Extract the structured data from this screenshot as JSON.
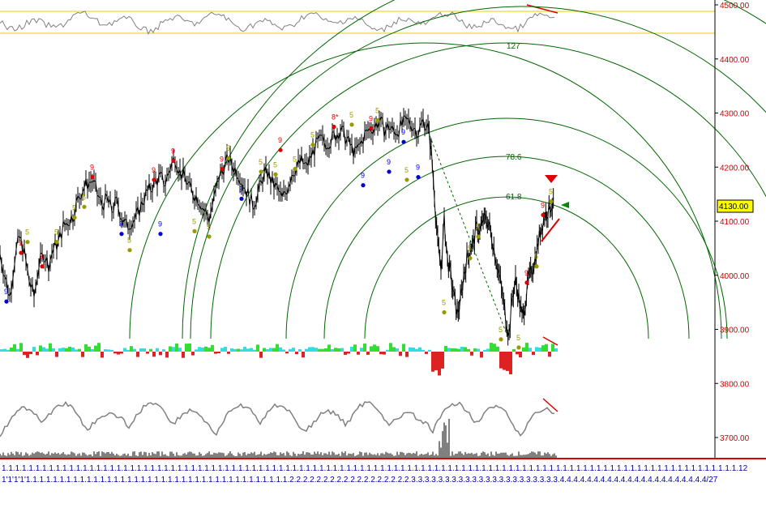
{
  "chart_data": {
    "type": "line",
    "title": "",
    "price_scale": {
      "ylim": [
        3660,
        4510
      ],
      "tick_labels": [
        "4500.00",
        "4400.00",
        "4300.00",
        "4200.00",
        "4100.00",
        "4000.00",
        "3900.00",
        "3800.00",
        "3700.00"
      ],
      "ticks": [
        4500,
        4400,
        4300,
        4200,
        4100,
        4000,
        3900,
        3800,
        3700
      ]
    },
    "current_price_label": "4130.00",
    "current_price": 4130,
    "x_axis_row1": "1.1.1.1.1.1.1.1.1.1.1.1.1.1.1.1.1.1.1.1.1.1.1.1.1.1.1.1.1.1.1.1.1.1.1.1.1.1.1.1.1.1.1.1.1.1.1.1.1.1.1.1.1.1.1.1.1.1.1.1.1.1.1.1.1.1.1.1.1.1.1.1.1.1.1.1.1.1.1.1.1.1.1.1.1.1.1.1.1.1.1.1.1.1.1.1.1.1.1.1.1.1.1.1.1.1.1.1.1.12",
    "x_axis_row2": "1'1'1'1'1.1.1.1.1.1.1.1.1.1.1.1.1.1.1.1.1.1.1.1.1.1.1.1.1.1.1.1.1.1.1.1.1.1.1.1.1.1.1.2.2.2.2.2.2.2.2.2.2.2.2.2.2.2.2.2.2.3.3.3.3.3.3.3.3.3.3.3.3.3.3.3.3.3.3.3.3.3.3.4.4.4.4.4.4.4.4.4.4.4.4.4.4.4.4.4.4.4.4.4.4/27",
    "fib_arc_labels": [
      "127",
      "78.6",
      "61.8"
    ],
    "price_series": [
      [
        0,
        4040
      ],
      [
        6,
        4000
      ],
      [
        12,
        3960
      ],
      [
        18,
        4030
      ],
      [
        24,
        4070
      ],
      [
        30,
        4040
      ],
      [
        36,
        3990
      ],
      [
        42,
        3960
      ],
      [
        48,
        4020
      ],
      [
        54,
        4040
      ],
      [
        60,
        4020
      ],
      [
        66,
        4050
      ],
      [
        72,
        4060
      ],
      [
        78,
        4090
      ],
      [
        84,
        4100
      ],
      [
        90,
        4110
      ],
      [
        96,
        4140
      ],
      [
        102,
        4160
      ],
      [
        108,
        4170
      ],
      [
        114,
        4175
      ],
      [
        120,
        4150
      ],
      [
        126,
        4130
      ],
      [
        132,
        4140
      ],
      [
        138,
        4120
      ],
      [
        144,
        4135
      ],
      [
        150,
        4110
      ],
      [
        156,
        4090
      ],
      [
        162,
        4100
      ],
      [
        168,
        4105
      ],
      [
        174,
        4130
      ],
      [
        180,
        4150
      ],
      [
        186,
        4160
      ],
      [
        192,
        4175
      ],
      [
        198,
        4180
      ],
      [
        204,
        4170
      ],
      [
        210,
        4200
      ],
      [
        216,
        4220
      ],
      [
        222,
        4190
      ],
      [
        228,
        4180
      ],
      [
        234,
        4160
      ],
      [
        240,
        4150
      ],
      [
        246,
        4140
      ],
      [
        252,
        4120
      ],
      [
        258,
        4105
      ],
      [
        264,
        4140
      ],
      [
        270,
        4180
      ],
      [
        276,
        4200
      ],
      [
        282,
        4215
      ],
      [
        288,
        4200
      ],
      [
        294,
        4190
      ],
      [
        300,
        4170
      ],
      [
        306,
        4150
      ],
      [
        312,
        4130
      ],
      [
        318,
        4150
      ],
      [
        324,
        4180
      ],
      [
        330,
        4190
      ],
      [
        336,
        4170
      ],
      [
        342,
        4160
      ],
      [
        348,
        4140
      ],
      [
        354,
        4160
      ],
      [
        360,
        4190
      ],
      [
        366,
        4200
      ],
      [
        372,
        4210
      ],
      [
        378,
        4200
      ],
      [
        384,
        4220
      ],
      [
        390,
        4240
      ],
      [
        396,
        4250
      ],
      [
        402,
        4245
      ],
      [
        408,
        4250
      ],
      [
        414,
        4260
      ],
      [
        420,
        4270
      ],
      [
        426,
        4255
      ],
      [
        432,
        4240
      ],
      [
        438,
        4225
      ],
      [
        444,
        4240
      ],
      [
        450,
        4260
      ],
      [
        456,
        4270
      ],
      [
        462,
        4275
      ],
      [
        468,
        4285
      ],
      [
        474,
        4270
      ],
      [
        480,
        4275
      ],
      [
        486,
        4265
      ],
      [
        492,
        4270
      ],
      [
        498,
        4280
      ],
      [
        504,
        4285
      ],
      [
        510,
        4275
      ],
      [
        516,
        4265
      ],
      [
        522,
        4285
      ],
      [
        528,
        4275
      ],
      [
        532,
        4230
      ],
      [
        536,
        4150
      ],
      [
        540,
        4060
      ],
      [
        544,
        4010
      ],
      [
        548,
        4100
      ],
      [
        552,
        4030
      ],
      [
        556,
        4000
      ],
      [
        560,
        3960
      ],
      [
        564,
        3930
      ],
      [
        568,
        3950
      ],
      [
        572,
        4000
      ],
      [
        576,
        4030
      ],
      [
        580,
        4050
      ],
      [
        584,
        4060
      ],
      [
        588,
        4090
      ],
      [
        592,
        4080
      ],
      [
        596,
        4100
      ],
      [
        600,
        4105
      ],
      [
        604,
        4090
      ],
      [
        608,
        4060
      ],
      [
        612,
        4030
      ],
      [
        616,
        4000
      ],
      [
        620,
        3960
      ],
      [
        624,
        3920
      ],
      [
        628,
        3890
      ],
      [
        632,
        3960
      ],
      [
        636,
        3990
      ],
      [
        640,
        3960
      ],
      [
        644,
        3920
      ],
      [
        648,
        3950
      ],
      [
        652,
        3990
      ],
      [
        656,
        4010
      ],
      [
        660,
        4030
      ],
      [
        664,
        4060
      ],
      [
        668,
        4090
      ],
      [
        672,
        4110
      ],
      [
        676,
        4120
      ],
      [
        680,
        4130
      ],
      [
        684,
        4128
      ]
    ],
    "count_markers": [
      {
        "x": 8,
        "y": 3965,
        "label": "9",
        "color": "blue"
      },
      {
        "x": 34,
        "y": 4075,
        "label": "5",
        "color": "olive"
      },
      {
        "x": 26,
        "y": 4055,
        "label": "9",
        "color": "red"
      },
      {
        "x": 52,
        "y": 4030,
        "label": "9",
        "color": "red"
      },
      {
        "x": 70,
        "y": 4075,
        "label": "5",
        "color": "olive"
      },
      {
        "x": 92,
        "y": 4120,
        "label": "5",
        "color": "olive"
      },
      {
        "x": 104,
        "y": 4140,
        "label": "5",
        "color": "olive"
      },
      {
        "x": 114,
        "y": 4195,
        "label": "9",
        "color": "red"
      },
      {
        "x": 150,
        "y": 4090,
        "label": "9",
        "color": "blue"
      },
      {
        "x": 160,
        "y": 4060,
        "label": "5",
        "color": "olive"
      },
      {
        "x": 190,
        "y": 4190,
        "label": "9",
        "color": "red"
      },
      {
        "x": 198,
        "y": 4090,
        "label": "9",
        "color": "blue"
      },
      {
        "x": 214,
        "y": 4225,
        "label": "9",
        "color": "red"
      },
      {
        "x": 240,
        "y": 4095,
        "label": "5",
        "color": "olive"
      },
      {
        "x": 258,
        "y": 4085,
        "label": "5",
        "color": "olive"
      },
      {
        "x": 274,
        "y": 4210,
        "label": "9",
        "color": "red"
      },
      {
        "x": 282,
        "y": 4230,
        "label": "5",
        "color": "olive"
      },
      {
        "x": 298,
        "y": 4155,
        "label": "9",
        "color": "blue"
      },
      {
        "x": 322,
        "y": 4205,
        "label": "5",
        "color": "olive"
      },
      {
        "x": 346,
        "y": 4245,
        "label": "9",
        "color": "red"
      },
      {
        "x": 340,
        "y": 4200,
        "label": "5",
        "color": "olive"
      },
      {
        "x": 364,
        "y": 4210,
        "label": "5",
        "color": "olive"
      },
      {
        "x": 386,
        "y": 4255,
        "label": "5",
        "color": "olive"
      },
      {
        "x": 412,
        "y": 4288,
        "label": "8*",
        "color": "red"
      },
      {
        "x": 434,
        "y": 4292,
        "label": "5",
        "color": "olive"
      },
      {
        "x": 448,
        "y": 4180,
        "label": "9",
        "color": "blue"
      },
      {
        "x": 458,
        "y": 4285,
        "label": "9",
        "color": "red"
      },
      {
        "x": 466,
        "y": 4300,
        "label": "5",
        "color": "olive"
      },
      {
        "x": 480,
        "y": 4205,
        "label": "9",
        "color": "blue"
      },
      {
        "x": 498,
        "y": 4260,
        "label": "9",
        "color": "blue"
      },
      {
        "x": 502,
        "y": 4190,
        "label": "5",
        "color": "olive"
      },
      {
        "x": 516,
        "y": 4195,
        "label": "9",
        "color": "blue"
      },
      {
        "x": 548,
        "y": 3945,
        "label": "5",
        "color": "olive"
      },
      {
        "x": 580,
        "y": 4045,
        "label": "5",
        "color": "olive"
      },
      {
        "x": 590,
        "y": 4085,
        "label": "5",
        "color": "olive"
      },
      {
        "x": 618,
        "y": 3895,
        "label": "5",
        "color": "olive"
      },
      {
        "x": 640,
        "y": 3880,
        "label": "5",
        "color": "olive"
      },
      {
        "x": 650,
        "y": 4000,
        "label": "9",
        "color": "red"
      },
      {
        "x": 662,
        "y": 4030,
        "label": "5",
        "color": "olive"
      },
      {
        "x": 670,
        "y": 4125,
        "label": "9",
        "color": "red"
      },
      {
        "x": 680,
        "y": 4150,
        "label": "5",
        "color": "olive"
      }
    ],
    "colors": {
      "price": "#000000",
      "arc": "#006600",
      "axis_text": "#cc0000",
      "date_text": "#0000aa",
      "oscillator": "#808080",
      "band": "#e6d200",
      "trend_marker": "#dd0000",
      "price_box": "#ffff00",
      "breadth_up": "#33dd33",
      "breadth_neutral": "#33dddd",
      "breadth_down": "#dd2222"
    }
  }
}
